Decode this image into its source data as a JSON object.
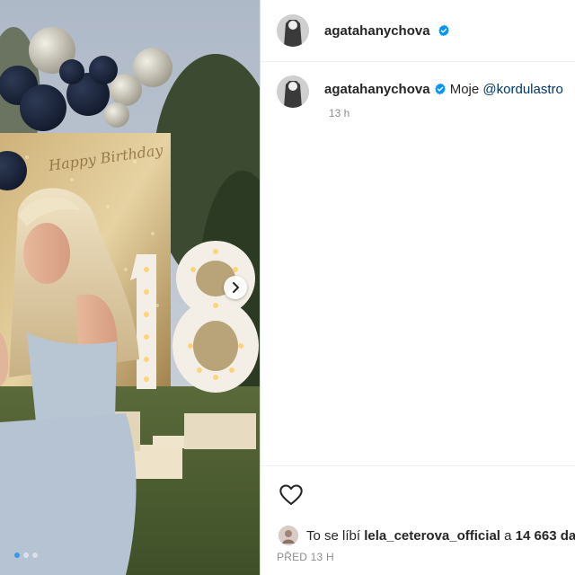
{
  "post": {
    "username": "agatahanychova",
    "caption_text": "Moje",
    "caption_mention": "@kordulastro",
    "time_ago": "13 h",
    "likes_prefix": "To se líbí",
    "liked_by": "lela_ceterova_official",
    "likes_connector": "a",
    "likes_count": "14 663 da",
    "posted_label": "PŘED 13 H",
    "photo_text_number": "18",
    "photo_text_script": "Happy Birthday",
    "carousel": {
      "total": 3,
      "active": 1
    }
  },
  "colors": {
    "verified": "#0095f6",
    "mention": "#00376b",
    "active_dot": "#3897f0"
  },
  "icons": {
    "next": "chevron-right-icon",
    "like": "heart-icon",
    "verified": "verified-badge-icon"
  }
}
